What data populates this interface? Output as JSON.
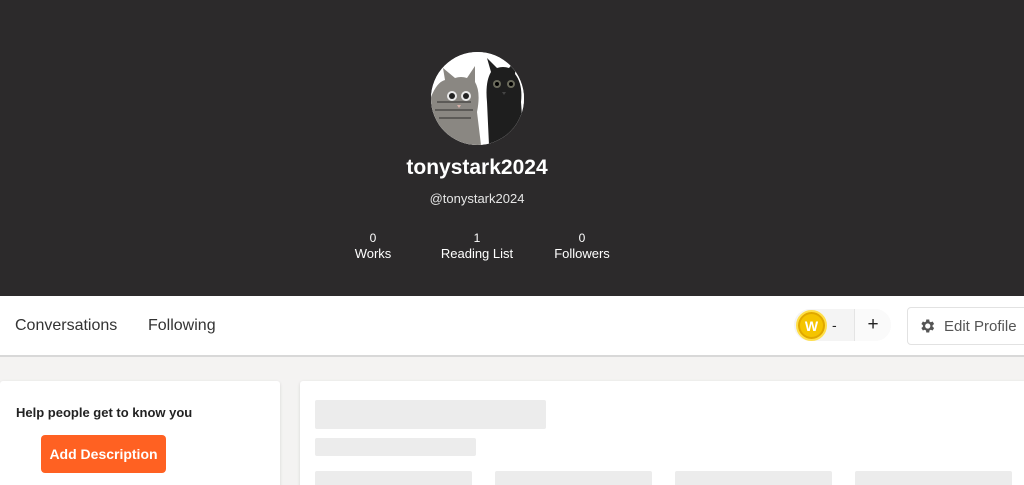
{
  "profile": {
    "display_name": "tonystark2024",
    "handle": "@tonystark2024",
    "avatar_icon": "two-cats-avatar"
  },
  "stats": [
    {
      "value": "0",
      "label": "Works"
    },
    {
      "value": "1",
      "label": "Reading List"
    },
    {
      "value": "0",
      "label": "Followers"
    }
  ],
  "nav": {
    "tabs": [
      {
        "label": "Conversations"
      },
      {
        "label": "Following"
      }
    ],
    "coins": {
      "icon": "wattpad-coin-icon",
      "letter": "W",
      "count": "-",
      "add_label": "+"
    },
    "edit_profile_label": "Edit Profile"
  },
  "about": {
    "prompt": "Help people get to know you",
    "add_description_label": "Add Description"
  },
  "colors": {
    "hero_bg": "#2c2a2b",
    "accent": "#ff6122",
    "coin": "#f5c400"
  }
}
